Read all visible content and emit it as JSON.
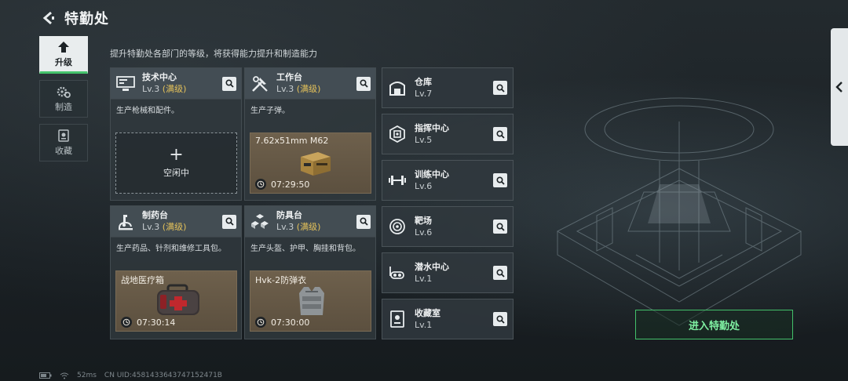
{
  "header": {
    "title": "特勤处"
  },
  "subtitle": "提升特勤处各部门的等级，将获得能力提升和制造能力",
  "tabs": [
    {
      "label": "升级",
      "icon": "upgrade-icon",
      "active": true
    },
    {
      "label": "制造",
      "icon": "gears-icon",
      "active": false
    },
    {
      "label": "收藏",
      "icon": "collection-icon",
      "active": false
    }
  ],
  "facilities": [
    {
      "name": "技术中心",
      "level": "Lv.3",
      "max": "(满级)",
      "icon": "computer-icon",
      "desc": "生产枪械和配件。",
      "slot": {
        "state": "idle",
        "label": "空闲中",
        "plus": "+"
      }
    },
    {
      "name": "工作台",
      "level": "Lv.3",
      "max": "(满级)",
      "icon": "tools-icon",
      "desc": "生产子弹。",
      "slot": {
        "state": "busy",
        "item": "7.62x51mm M62",
        "time": "07:29:50"
      }
    },
    {
      "name": "制药台",
      "level": "Lv.3",
      "max": "(满级)",
      "icon": "microscope-icon",
      "desc": "生产药品、针剂和维修工具包。",
      "slot": {
        "state": "busy",
        "item": "战地医疗箱",
        "time": "07:30:14"
      }
    },
    {
      "name": "防具台",
      "level": "Lv.3",
      "max": "(满级)",
      "icon": "armor-blocks-icon",
      "desc": "生产头盔、护甲、胸挂和背包。",
      "slot": {
        "state": "busy",
        "item": "Hvk-2防弹衣",
        "time": "07:30:00"
      }
    }
  ],
  "departments": [
    {
      "name": "仓库",
      "level": "Lv.7",
      "icon": "warehouse-icon"
    },
    {
      "name": "指挥中心",
      "level": "Lv.5",
      "icon": "chip-icon"
    },
    {
      "name": "训练中心",
      "level": "Lv.6",
      "icon": "dumbbell-icon"
    },
    {
      "name": "靶场",
      "level": "Lv.6",
      "icon": "target-icon"
    },
    {
      "name": "潜水中心",
      "level": "Lv.1",
      "icon": "diving-mask-icon"
    },
    {
      "name": "收藏室",
      "level": "Lv.1",
      "icon": "trophy-icon"
    }
  ],
  "enter_button": "进入特勤处",
  "status": {
    "ping": "52ms",
    "uid": "CN UID:4581433643747152471B"
  },
  "colors": {
    "accent_green": "#43c06a",
    "max_level": "#e5c25a",
    "slot_busy": "#6e604c"
  }
}
